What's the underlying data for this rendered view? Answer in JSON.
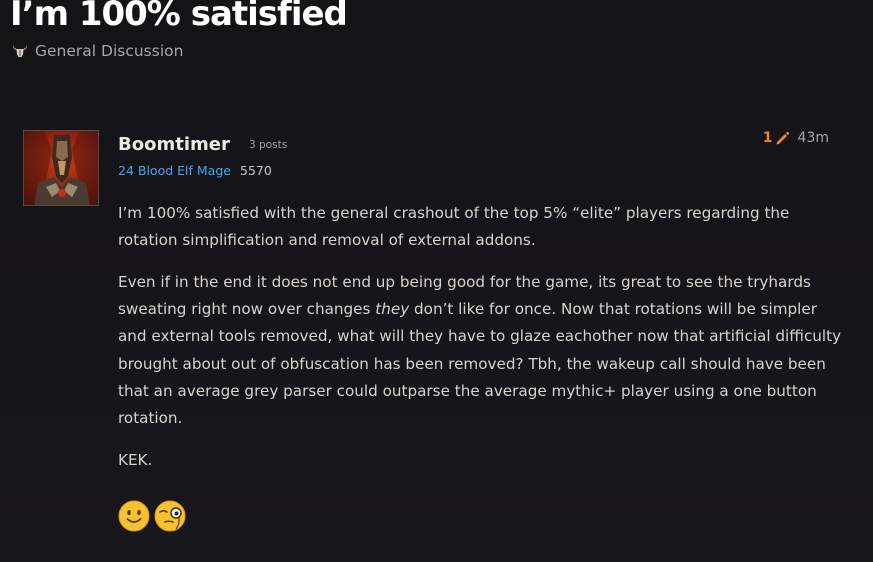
{
  "topic": {
    "title": "I’m 100% satisfied",
    "category_icon": "horned-helmet-icon",
    "category": "General Discussion"
  },
  "post": {
    "username": "Boomtimer",
    "post_count": "3 posts",
    "character": "24 Blood Elf Mage",
    "achievement_points": "5570",
    "edit_count": "1",
    "edit_icon": "pencil-icon",
    "time": "43m",
    "paragraphs": {
      "p1": "I’m 100% satisfied with the general crashout of the top 5% “elite” players regarding the rotation simplification and removal of external addons.",
      "p2_before": "Even if in the end it does not end up being good for the game, its great to see the tryhards sweating right now over changes ",
      "p2_em": "they",
      "p2_after": " don’t like for once. Now that rotations will be simpler and external tools removed, what will they have to glaze eachother now that artificial difficulty brought about out of obfuscation has been removed? Tbh, the wakeup call should have been that an average grey parser could outparse the average mythic+ player using a one button rotation.",
      "p3": "KEK."
    },
    "emojis": [
      "slightly-smiling-face-icon",
      "face-with-monocle-icon"
    ]
  },
  "colors": {
    "background": "#16151a",
    "title": "#ffffff",
    "class_color": "#3fa9f5",
    "edit_accent": "#f1841b"
  }
}
